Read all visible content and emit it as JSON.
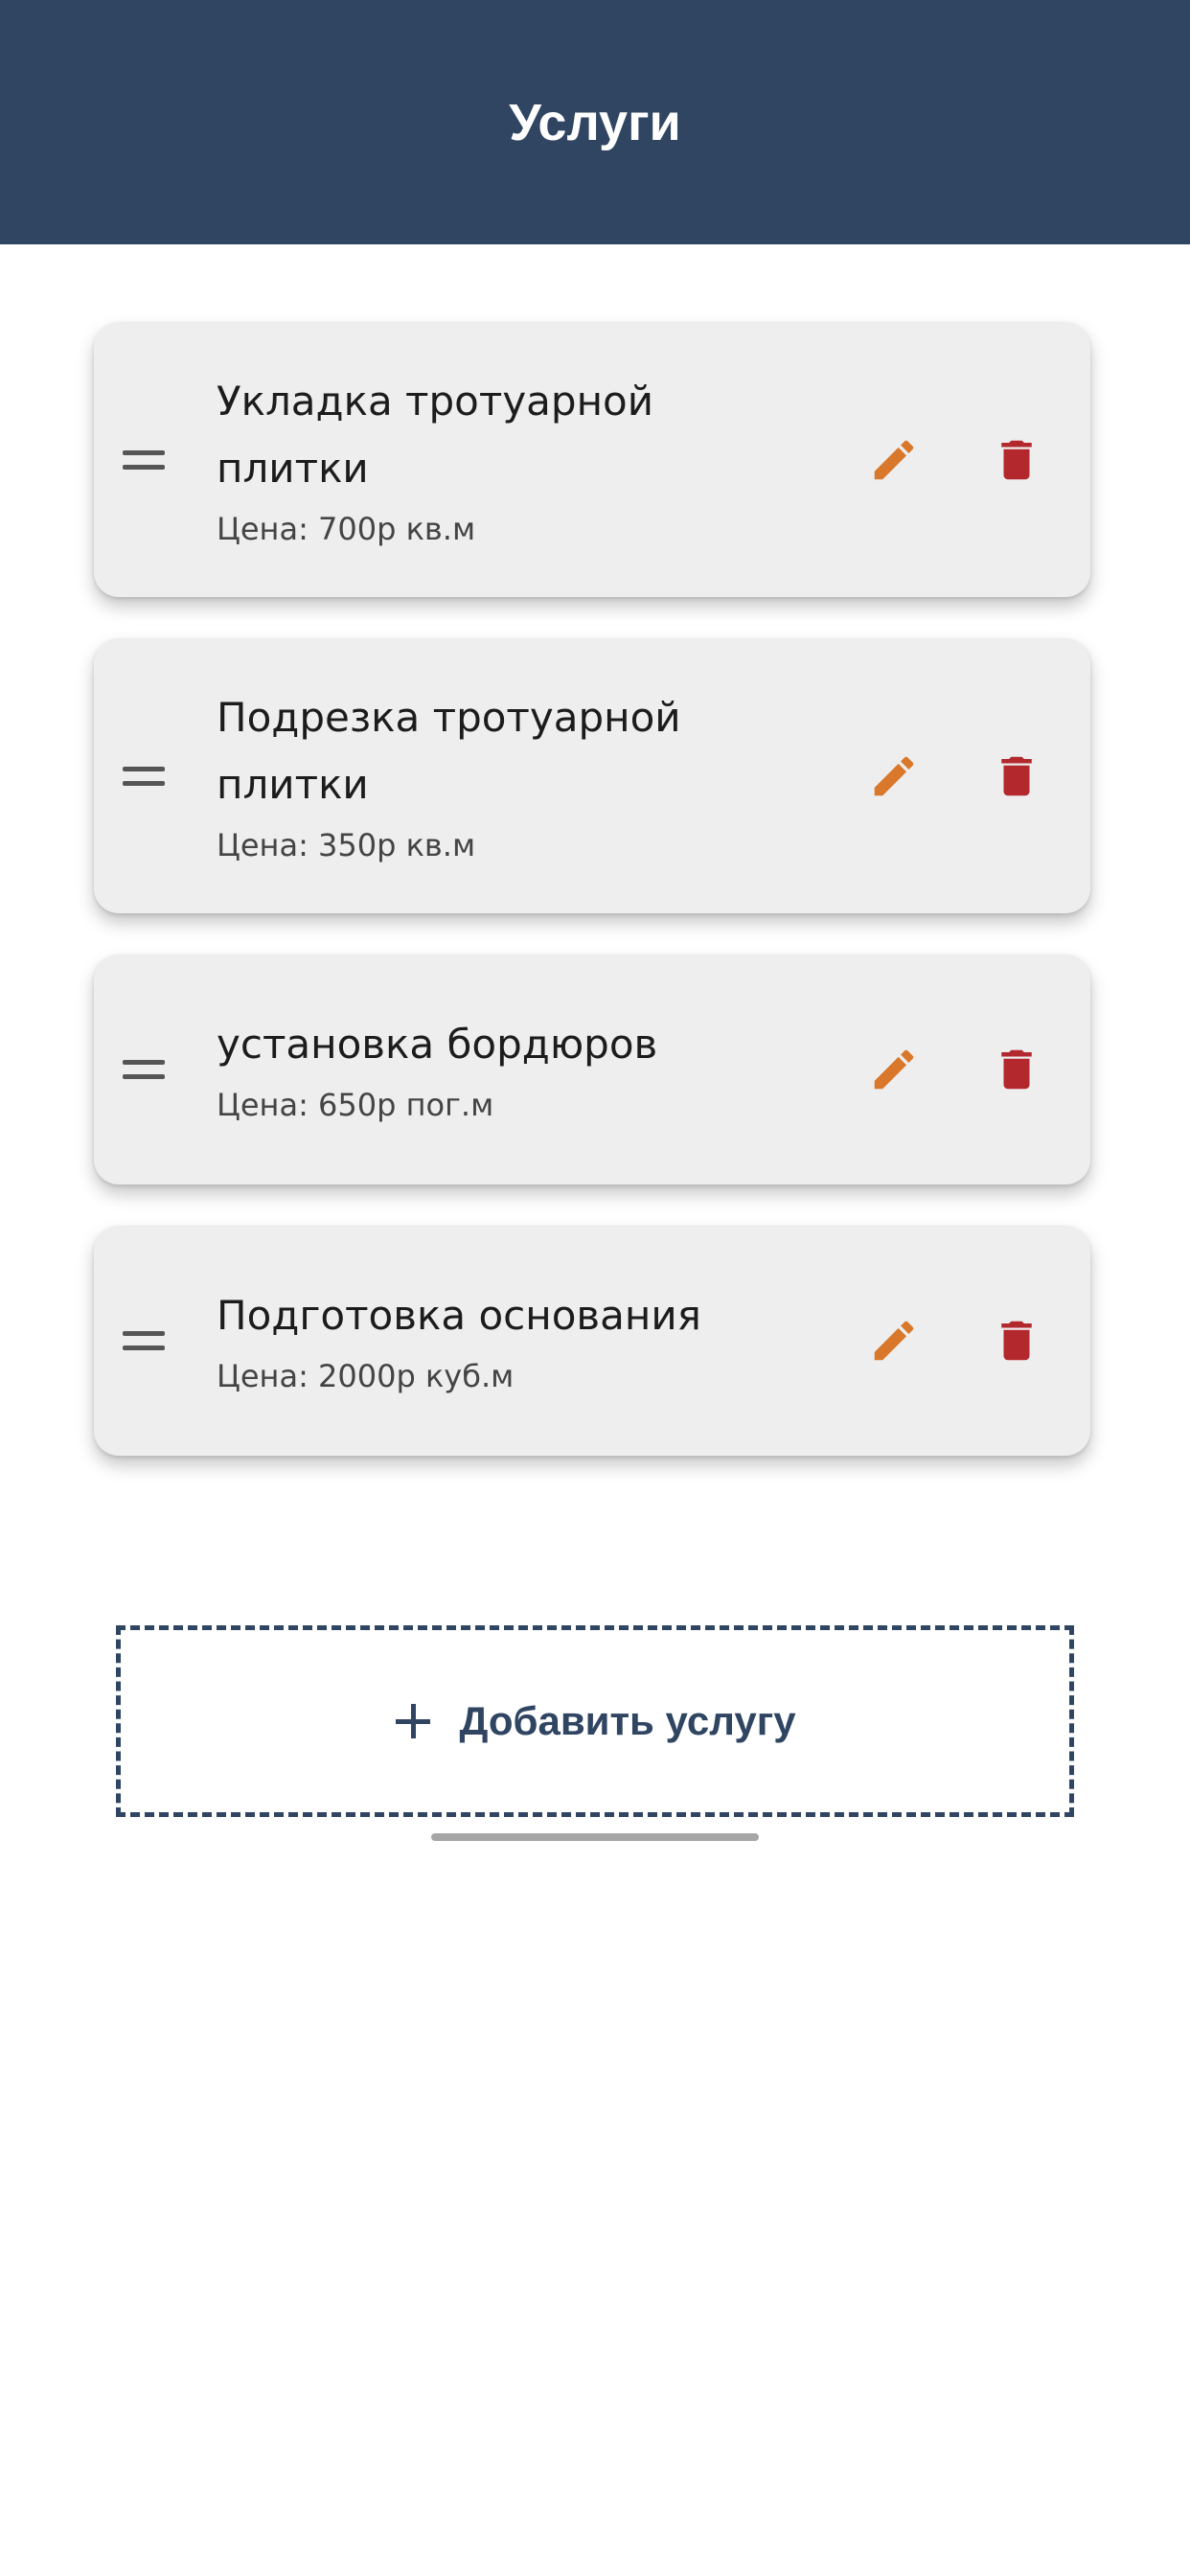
{
  "header": {
    "title": "Услуги"
  },
  "services": [
    {
      "title_line1": "Укладка тротуарной",
      "title_line2": "плитки",
      "price": "Цена: 700р кв.м"
    },
    {
      "title_line1": "Подрезка тротуарной",
      "title_line2": "плитки",
      "price": "Цена: 350р кв.м"
    },
    {
      "title_line1": "установка бордюров",
      "price": "Цена: 650р пог.м"
    },
    {
      "title_line1": "Подготовка основания",
      "price": "Цена: 2000р куб.м"
    }
  ],
  "add_button": {
    "label": "Добавить услугу",
    "icon": "plus-icon"
  },
  "icons": {
    "drag": "drag-handle-icon",
    "edit": "pencil-icon",
    "delete": "trash-icon"
  },
  "colors": {
    "header_bg": "#2f4562",
    "edit_icon": "#d9782a",
    "delete_icon": "#b3282d",
    "card_bg": "#eeeeee"
  }
}
